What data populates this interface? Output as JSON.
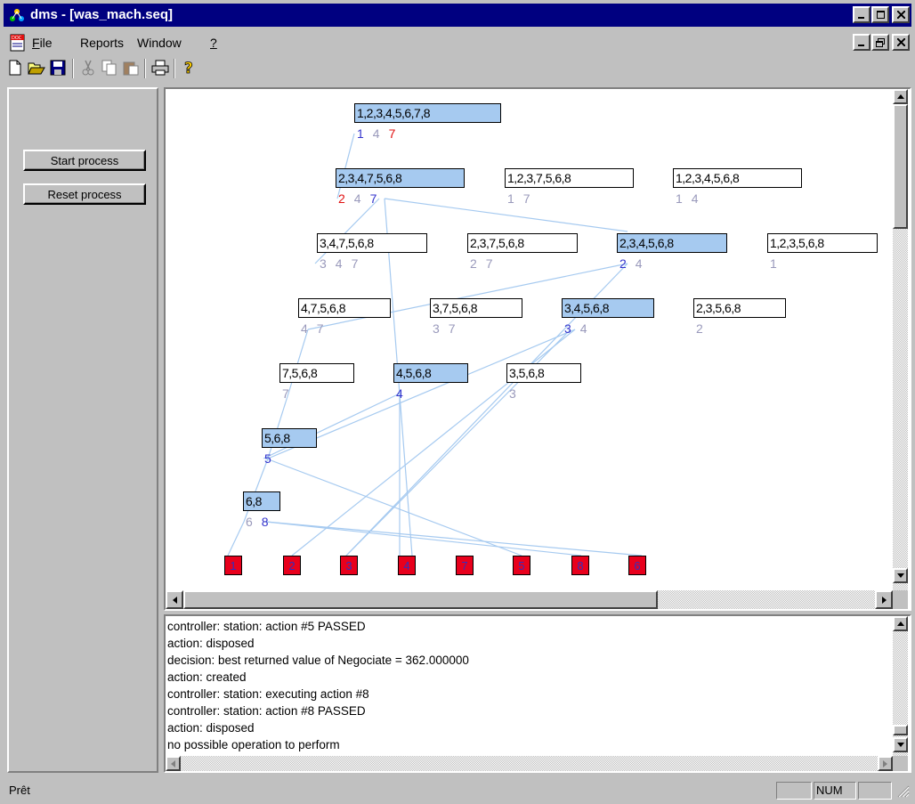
{
  "window": {
    "title": "dms - [was_mach.seq]"
  },
  "menu": {
    "items": [
      {
        "label": "File",
        "accel": "F"
      },
      {
        "label": "Reports",
        "accel": ""
      },
      {
        "label": "Window",
        "accel": ""
      },
      {
        "label": "?",
        "accel": "?"
      }
    ]
  },
  "toolbar": {
    "icons": [
      "new-icon",
      "open-icon",
      "save-icon",
      "cut-icon",
      "copy-icon",
      "paste-icon",
      "print-icon",
      "help-icon"
    ]
  },
  "side": {
    "start_label": "Start process",
    "reset_label": "Reset process"
  },
  "graph": {
    "nodes": [
      {
        "id": "n0",
        "text": "1,2,3,4,5,6,7,8",
        "selected": true
      },
      {
        "id": "n1",
        "text": "2,3,4,7,5,6,8",
        "selected": true
      },
      {
        "id": "n2",
        "text": "1,2,3,7,5,6,8",
        "selected": false
      },
      {
        "id": "n3",
        "text": "1,2,3,4,5,6,8",
        "selected": false
      },
      {
        "id": "n4",
        "text": "3,4,7,5,6,8",
        "selected": false
      },
      {
        "id": "n5",
        "text": "2,3,7,5,6,8",
        "selected": false
      },
      {
        "id": "n6",
        "text": "2,3,4,5,6,8",
        "selected": true
      },
      {
        "id": "n7",
        "text": "1,2,3,5,6,8",
        "selected": false
      },
      {
        "id": "n8",
        "text": "4,7,5,6,8",
        "selected": false
      },
      {
        "id": "n9",
        "text": "3,7,5,6,8",
        "selected": false
      },
      {
        "id": "n10",
        "text": "3,4,5,6,8",
        "selected": true
      },
      {
        "id": "n11",
        "text": "2,3,5,6,8",
        "selected": false
      },
      {
        "id": "n12",
        "text": "7,5,6,8",
        "selected": false
      },
      {
        "id": "n13",
        "text": "4,5,6,8",
        "selected": true
      },
      {
        "id": "n14",
        "text": "3,5,6,8",
        "selected": false
      },
      {
        "id": "n15",
        "text": "5,6,8",
        "selected": true
      },
      {
        "id": "n16",
        "text": "6,8",
        "selected": true
      }
    ],
    "labels": [
      [
        {
          "t": "1",
          "c": "#3333cc"
        },
        {
          "t": "4",
          "c": "#9999bb"
        },
        {
          "t": "7",
          "c": "#e01010"
        }
      ],
      [
        {
          "t": "2",
          "c": "#e01010"
        },
        {
          "t": "4",
          "c": "#9999bb"
        },
        {
          "t": "7",
          "c": "#3333cc"
        }
      ],
      [
        {
          "t": "1",
          "c": "#9999bb"
        },
        {
          "t": "7",
          "c": "#9999bb"
        }
      ],
      [
        {
          "t": "1",
          "c": "#9999bb"
        },
        {
          "t": "4",
          "c": "#9999bb"
        }
      ],
      [
        {
          "t": "3",
          "c": "#9999bb"
        },
        {
          "t": "4",
          "c": "#9999bb"
        },
        {
          "t": "7",
          "c": "#9999bb"
        }
      ],
      [
        {
          "t": "2",
          "c": "#9999bb"
        },
        {
          "t": "7",
          "c": "#9999bb"
        }
      ],
      [
        {
          "t": "2",
          "c": "#3333cc"
        },
        {
          "t": "4",
          "c": "#9999bb"
        }
      ],
      [
        {
          "t": "1",
          "c": "#9999bb"
        }
      ],
      [
        {
          "t": "4",
          "c": "#9999bb"
        },
        {
          "t": "7",
          "c": "#9999bb"
        }
      ],
      [
        {
          "t": "3",
          "c": "#9999bb"
        },
        {
          "t": "7",
          "c": "#9999bb"
        }
      ],
      [
        {
          "t": "3",
          "c": "#3333cc"
        },
        {
          "t": "4",
          "c": "#9999bb"
        }
      ],
      [
        {
          "t": "2",
          "c": "#9999bb"
        }
      ],
      [
        {
          "t": "7",
          "c": "#9999bb"
        }
      ],
      [
        {
          "t": "4",
          "c": "#3333cc"
        }
      ],
      [
        {
          "t": "3",
          "c": "#9999bb"
        }
      ],
      [
        {
          "t": "5",
          "c": "#3333cc"
        }
      ],
      [
        {
          "t": "6",
          "c": "#9999bb"
        },
        {
          "t": "8",
          "c": "#3333cc"
        }
      ]
    ],
    "sequence": [
      "1",
      "2",
      "3",
      "4",
      "7",
      "5",
      "8",
      "6"
    ],
    "colors": {
      "selected": "#a6caf0",
      "edge": "#a6caf0",
      "sequence_fill": "#e8001c",
      "sequence_text": "#3030c0"
    }
  },
  "log": {
    "lines": [
      "controller: station: action #5 PASSED",
      "action: disposed",
      "decision: best returned value of Negociate = 362.000000",
      "action: created",
      "controller: station: executing action #8",
      "controller: station: action #8 PASSED",
      "action: disposed",
      "no possible operation to perform"
    ]
  },
  "status": {
    "text": "Prêt",
    "num": "NUM"
  }
}
